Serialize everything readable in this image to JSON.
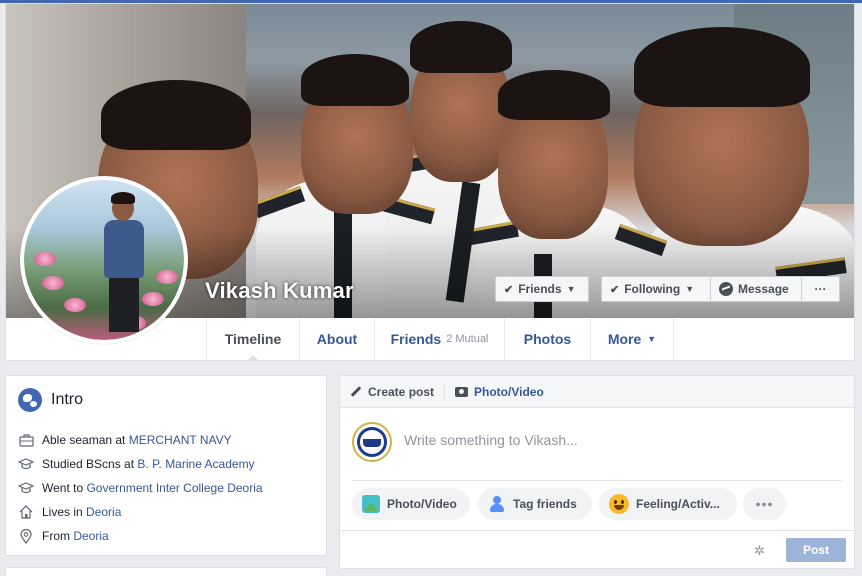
{
  "profile": {
    "name": "Vikash Kumar"
  },
  "actions": {
    "friends_label": "Friends",
    "following_label": "Following",
    "message_label": "Message",
    "more_label": "···"
  },
  "nav": {
    "tabs": [
      {
        "label": "Timeline",
        "active": true
      },
      {
        "label": "About"
      },
      {
        "label": "Friends",
        "sub": "2 Mutual"
      },
      {
        "label": "Photos"
      },
      {
        "label": "More"
      }
    ]
  },
  "intro": {
    "title": "Intro",
    "items": [
      {
        "icon": "briefcase-icon",
        "prefix": "Able seaman at ",
        "link": "MERCHANT NAVY"
      },
      {
        "icon": "graduation-cap-icon",
        "prefix": "Studied BScns at ",
        "link": "B. P. Marine Academy"
      },
      {
        "icon": "graduation-cap-icon",
        "prefix": "Went to ",
        "link": "Government Inter College Deoria"
      },
      {
        "icon": "home-icon",
        "prefix": "Lives in ",
        "link": "Deoria"
      },
      {
        "icon": "location-pin-icon",
        "prefix": "From ",
        "link": "Deoria"
      }
    ]
  },
  "composer": {
    "tab_create": "Create post",
    "tab_photo": "Photo/Video",
    "placeholder": "Write something to Vikash...",
    "pills": {
      "photo": "Photo/Video",
      "tag": "Tag friends",
      "feeling": "Feeling/Activ...",
      "more": "•••"
    },
    "post_label": "Post"
  },
  "colors": {
    "brand": "#4267b2",
    "link": "#365899",
    "post_disabled": "#9cb4d8"
  }
}
